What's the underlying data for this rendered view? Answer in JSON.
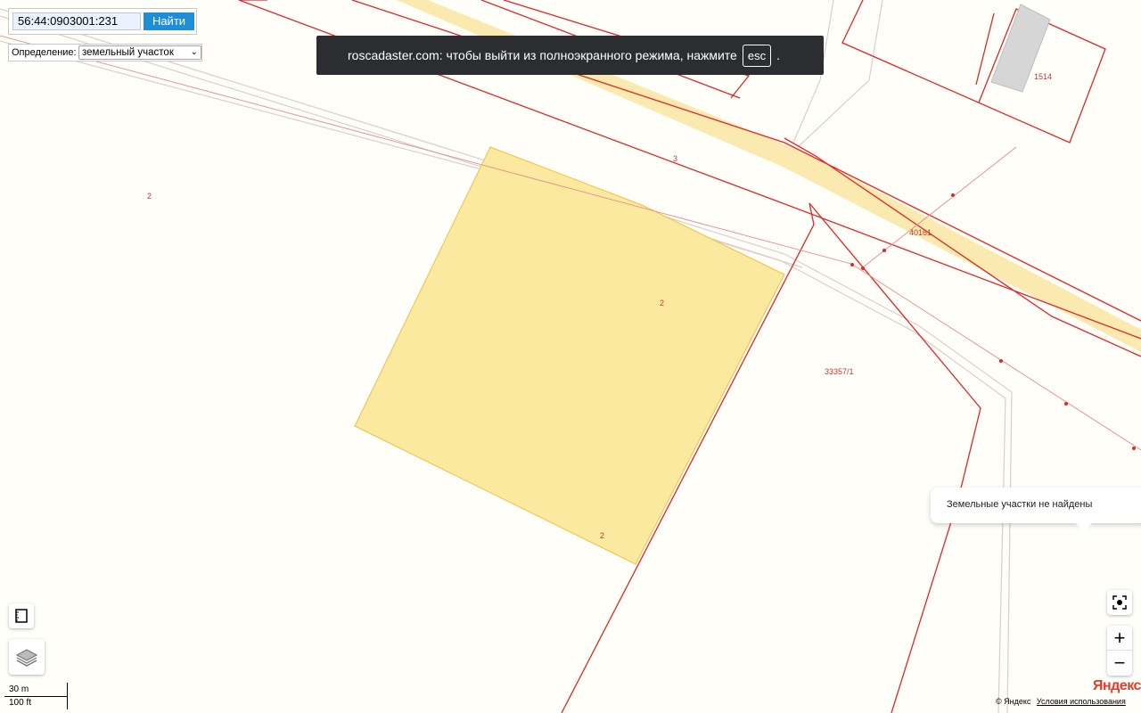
{
  "search": {
    "value": "56:44:0903001:231",
    "button_label": "Найти"
  },
  "definition": {
    "label": "Определение:",
    "selected": "земельный участок"
  },
  "toast": {
    "text": "roscadaster.com: чтобы выйти из полноэкранного режима, нажмите",
    "key": "esc",
    "suffix": "."
  },
  "map_labels": [
    "2",
    "3",
    "1514",
    "40161",
    "2",
    "33357/1",
    "2"
  ],
  "popup": {
    "text": "Земельные участки не найдены"
  },
  "controls": {
    "ruler_icon": "ruler-icon",
    "layers_icon": "layers-icon",
    "locate_icon": "locate-icon",
    "zoom_in": "+",
    "zoom_out": "−"
  },
  "scale": {
    "metric": "30 m",
    "imperial": "100 ft"
  },
  "footer": {
    "copyright": "© Яндекс",
    "terms": "Условия использования",
    "brand": "Яндекс"
  },
  "colors": {
    "parcel_border": "#e0262a",
    "selected_fill": "#fbe9a0",
    "road_fill": "#fbeab0",
    "background": "#fffef8"
  }
}
